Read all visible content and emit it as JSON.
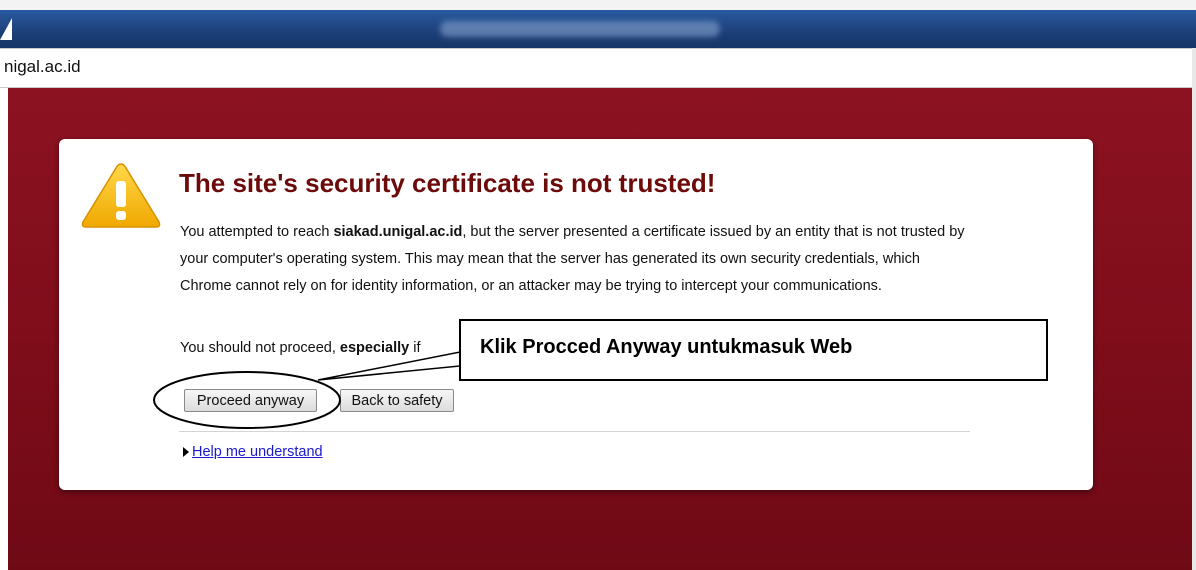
{
  "browser": {
    "address": "nigal.ac.id"
  },
  "warning": {
    "title": "The site's security certificate is not trusted!",
    "body_pre": "You attempted to reach ",
    "host": "siakad.unigal.ac.id",
    "body_post": ", but the server presented a certificate issued by an entity that is not trusted by your computer's operating system. This may mean that the server has generated its own security credentials, which Chrome cannot rely on for identity information, or an attacker may be trying to intercept your communications.",
    "advice_pre": "You should not proceed, ",
    "advice_bold": "especially",
    "advice_post": " if",
    "proceed_label": "Proceed anyway",
    "back_label": "Back to safety",
    "help_label": "Help me understand"
  },
  "annotation": {
    "callout_text": "Klik Procced Anyway  untukmasuk Web"
  },
  "colors": {
    "page_background": "#7e0d1a",
    "title": "#6d0a0a",
    "link": "#1a1ad0"
  },
  "icons": {
    "warning": "warning-triangle-icon",
    "disclosure": "disclosure-triangle-icon"
  }
}
